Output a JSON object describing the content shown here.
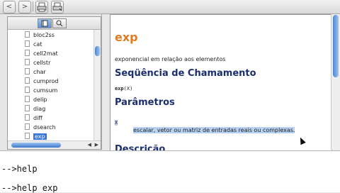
{
  "toolbar": {
    "back": "<",
    "forward": ">"
  },
  "sidebar": {
    "tabs": [
      "index",
      "search"
    ],
    "items": [
      "bloc2ss",
      "cat",
      "cell2mat",
      "cellstr",
      "char",
      "cumprod",
      "cumsum",
      "delip",
      "diag",
      "diff",
      "dsearch",
      "exp"
    ],
    "selected_index": 11
  },
  "doc": {
    "title": "exp",
    "summary": "exponencial em relação aos elementos",
    "calling_heading": "Seqüência de Chamamento",
    "calling_fn": "exp",
    "calling_args": "(X)",
    "params_heading": "Parâmetros",
    "param_name": "X",
    "param_desc": "escalar, vetor ou matriz de entradas reais ou complexas.",
    "next_heading": "Descrição"
  },
  "console": {
    "lines": [
      "-->help",
      "-->help exp"
    ]
  }
}
